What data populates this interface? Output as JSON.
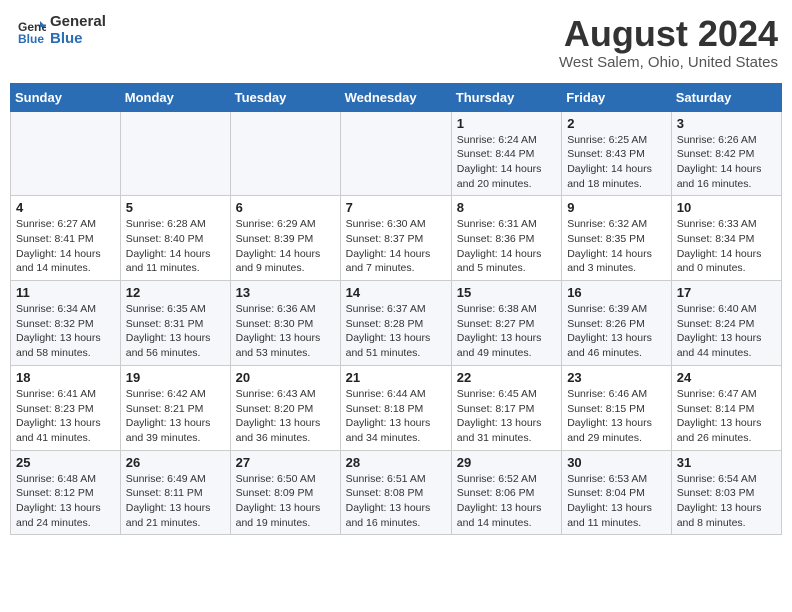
{
  "header": {
    "logo_general": "General",
    "logo_blue": "Blue",
    "month_title": "August 2024",
    "location": "West Salem, Ohio, United States"
  },
  "weekdays": [
    "Sunday",
    "Monday",
    "Tuesday",
    "Wednesday",
    "Thursday",
    "Friday",
    "Saturday"
  ],
  "weeks": [
    [
      {
        "day": "",
        "info": ""
      },
      {
        "day": "",
        "info": ""
      },
      {
        "day": "",
        "info": ""
      },
      {
        "day": "",
        "info": ""
      },
      {
        "day": "1",
        "info": "Sunrise: 6:24 AM\nSunset: 8:44 PM\nDaylight: 14 hours\nand 20 minutes."
      },
      {
        "day": "2",
        "info": "Sunrise: 6:25 AM\nSunset: 8:43 PM\nDaylight: 14 hours\nand 18 minutes."
      },
      {
        "day": "3",
        "info": "Sunrise: 6:26 AM\nSunset: 8:42 PM\nDaylight: 14 hours\nand 16 minutes."
      }
    ],
    [
      {
        "day": "4",
        "info": "Sunrise: 6:27 AM\nSunset: 8:41 PM\nDaylight: 14 hours\nand 14 minutes."
      },
      {
        "day": "5",
        "info": "Sunrise: 6:28 AM\nSunset: 8:40 PM\nDaylight: 14 hours\nand 11 minutes."
      },
      {
        "day": "6",
        "info": "Sunrise: 6:29 AM\nSunset: 8:39 PM\nDaylight: 14 hours\nand 9 minutes."
      },
      {
        "day": "7",
        "info": "Sunrise: 6:30 AM\nSunset: 8:37 PM\nDaylight: 14 hours\nand 7 minutes."
      },
      {
        "day": "8",
        "info": "Sunrise: 6:31 AM\nSunset: 8:36 PM\nDaylight: 14 hours\nand 5 minutes."
      },
      {
        "day": "9",
        "info": "Sunrise: 6:32 AM\nSunset: 8:35 PM\nDaylight: 14 hours\nand 3 minutes."
      },
      {
        "day": "10",
        "info": "Sunrise: 6:33 AM\nSunset: 8:34 PM\nDaylight: 14 hours\nand 0 minutes."
      }
    ],
    [
      {
        "day": "11",
        "info": "Sunrise: 6:34 AM\nSunset: 8:32 PM\nDaylight: 13 hours\nand 58 minutes."
      },
      {
        "day": "12",
        "info": "Sunrise: 6:35 AM\nSunset: 8:31 PM\nDaylight: 13 hours\nand 56 minutes."
      },
      {
        "day": "13",
        "info": "Sunrise: 6:36 AM\nSunset: 8:30 PM\nDaylight: 13 hours\nand 53 minutes."
      },
      {
        "day": "14",
        "info": "Sunrise: 6:37 AM\nSunset: 8:28 PM\nDaylight: 13 hours\nand 51 minutes."
      },
      {
        "day": "15",
        "info": "Sunrise: 6:38 AM\nSunset: 8:27 PM\nDaylight: 13 hours\nand 49 minutes."
      },
      {
        "day": "16",
        "info": "Sunrise: 6:39 AM\nSunset: 8:26 PM\nDaylight: 13 hours\nand 46 minutes."
      },
      {
        "day": "17",
        "info": "Sunrise: 6:40 AM\nSunset: 8:24 PM\nDaylight: 13 hours\nand 44 minutes."
      }
    ],
    [
      {
        "day": "18",
        "info": "Sunrise: 6:41 AM\nSunset: 8:23 PM\nDaylight: 13 hours\nand 41 minutes."
      },
      {
        "day": "19",
        "info": "Sunrise: 6:42 AM\nSunset: 8:21 PM\nDaylight: 13 hours\nand 39 minutes."
      },
      {
        "day": "20",
        "info": "Sunrise: 6:43 AM\nSunset: 8:20 PM\nDaylight: 13 hours\nand 36 minutes."
      },
      {
        "day": "21",
        "info": "Sunrise: 6:44 AM\nSunset: 8:18 PM\nDaylight: 13 hours\nand 34 minutes."
      },
      {
        "day": "22",
        "info": "Sunrise: 6:45 AM\nSunset: 8:17 PM\nDaylight: 13 hours\nand 31 minutes."
      },
      {
        "day": "23",
        "info": "Sunrise: 6:46 AM\nSunset: 8:15 PM\nDaylight: 13 hours\nand 29 minutes."
      },
      {
        "day": "24",
        "info": "Sunrise: 6:47 AM\nSunset: 8:14 PM\nDaylight: 13 hours\nand 26 minutes."
      }
    ],
    [
      {
        "day": "25",
        "info": "Sunrise: 6:48 AM\nSunset: 8:12 PM\nDaylight: 13 hours\nand 24 minutes."
      },
      {
        "day": "26",
        "info": "Sunrise: 6:49 AM\nSunset: 8:11 PM\nDaylight: 13 hours\nand 21 minutes."
      },
      {
        "day": "27",
        "info": "Sunrise: 6:50 AM\nSunset: 8:09 PM\nDaylight: 13 hours\nand 19 minutes."
      },
      {
        "day": "28",
        "info": "Sunrise: 6:51 AM\nSunset: 8:08 PM\nDaylight: 13 hours\nand 16 minutes."
      },
      {
        "day": "29",
        "info": "Sunrise: 6:52 AM\nSunset: 8:06 PM\nDaylight: 13 hours\nand 14 minutes."
      },
      {
        "day": "30",
        "info": "Sunrise: 6:53 AM\nSunset: 8:04 PM\nDaylight: 13 hours\nand 11 minutes."
      },
      {
        "day": "31",
        "info": "Sunrise: 6:54 AM\nSunset: 8:03 PM\nDaylight: 13 hours\nand 8 minutes."
      }
    ]
  ]
}
